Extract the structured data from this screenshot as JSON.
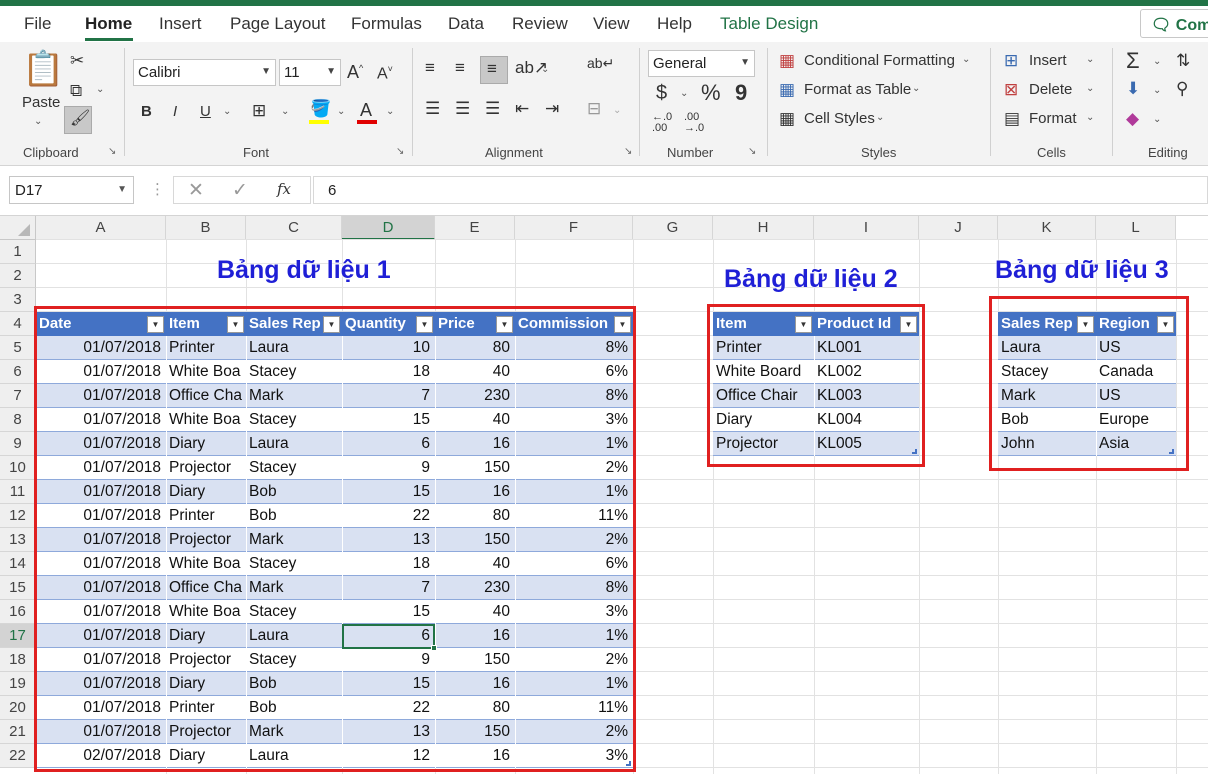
{
  "ribbon_tabs": [
    "File",
    "Home",
    "Insert",
    "Page Layout",
    "Formulas",
    "Data",
    "Review",
    "View",
    "Help",
    "Table Design"
  ],
  "comments_label": "Comm",
  "clipboard": {
    "paste_label": "Paste",
    "group_label": "Clipboard"
  },
  "font": {
    "name": "Calibri",
    "size": "11",
    "group_label": "Font"
  },
  "alignment": {
    "group_label": "Alignment"
  },
  "number": {
    "format": "General",
    "group_label": "Number",
    "currency": "$",
    "percent": "%",
    "comma": "9"
  },
  "styles": {
    "conditional": "Conditional Formatting",
    "format_table": "Format as Table",
    "cell_styles": "Cell Styles",
    "group_label": "Styles"
  },
  "cells": {
    "insert": "Insert",
    "delete": "Delete",
    "format": "Format",
    "group_label": "Cells"
  },
  "editing": {
    "group_label": "Editing",
    "sum": "Σ"
  },
  "formula_bar": {
    "name_box": "D17",
    "value": "6",
    "fx": "fx"
  },
  "columns": [
    "A",
    "B",
    "C",
    "D",
    "E",
    "F",
    "G",
    "H",
    "I",
    "J",
    "K",
    "L"
  ],
  "rows": [
    "1",
    "2",
    "3",
    "4",
    "5",
    "6",
    "7",
    "8",
    "9",
    "10",
    "11",
    "12",
    "13",
    "14",
    "15",
    "16",
    "17",
    "18",
    "19",
    "20",
    "21",
    "22"
  ],
  "selected_cell": "D17",
  "titles": {
    "t1": "Bảng dữ liệu 1",
    "t2": "Bảng dữ liệu 2",
    "t3": "Bảng dữ liệu 3"
  },
  "table1": {
    "headers": [
      "Date",
      "Item",
      "Sales Rep",
      "Quantity",
      "Price",
      "Commission"
    ],
    "rows": [
      [
        "01/07/2018",
        "Printer",
        "Laura",
        "10",
        "80",
        "8%"
      ],
      [
        "01/07/2018",
        "White Boa",
        "Stacey",
        "18",
        "40",
        "6%"
      ],
      [
        "01/07/2018",
        "Office Cha",
        "Mark",
        "7",
        "230",
        "8%"
      ],
      [
        "01/07/2018",
        "White Boa",
        "Stacey",
        "15",
        "40",
        "3%"
      ],
      [
        "01/07/2018",
        "Diary",
        "Laura",
        "6",
        "16",
        "1%"
      ],
      [
        "01/07/2018",
        "Projector",
        "Stacey",
        "9",
        "150",
        "2%"
      ],
      [
        "01/07/2018",
        "Diary",
        "Bob",
        "15",
        "16",
        "1%"
      ],
      [
        "01/07/2018",
        "Printer",
        "Bob",
        "22",
        "80",
        "11%"
      ],
      [
        "01/07/2018",
        "Projector",
        "Mark",
        "13",
        "150",
        "2%"
      ],
      [
        "01/07/2018",
        "White Boa",
        "Stacey",
        "18",
        "40",
        "6%"
      ],
      [
        "01/07/2018",
        "Office Cha",
        "Mark",
        "7",
        "230",
        "8%"
      ],
      [
        "01/07/2018",
        "White Boa",
        "Stacey",
        "15",
        "40",
        "3%"
      ],
      [
        "01/07/2018",
        "Diary",
        "Laura",
        "6",
        "16",
        "1%"
      ],
      [
        "01/07/2018",
        "Projector",
        "Stacey",
        "9",
        "150",
        "2%"
      ],
      [
        "01/07/2018",
        "Diary",
        "Bob",
        "15",
        "16",
        "1%"
      ],
      [
        "01/07/2018",
        "Printer",
        "Bob",
        "22",
        "80",
        "11%"
      ],
      [
        "01/07/2018",
        "Projector",
        "Mark",
        "13",
        "150",
        "2%"
      ],
      [
        "02/07/2018",
        "Diary",
        "Laura",
        "12",
        "16",
        "3%"
      ]
    ]
  },
  "table2": {
    "headers": [
      "Item",
      "Product Id"
    ],
    "rows": [
      [
        "Printer",
        "KL001"
      ],
      [
        "White Board",
        "KL002"
      ],
      [
        "Office Chair",
        "KL003"
      ],
      [
        "Diary",
        "KL004"
      ],
      [
        "Projector",
        "KL005"
      ]
    ]
  },
  "table3": {
    "headers": [
      "Sales Rep",
      "Region"
    ],
    "rows": [
      [
        "Laura",
        "US"
      ],
      [
        "Stacey",
        "Canada"
      ],
      [
        "Mark",
        "US"
      ],
      [
        "Bob",
        "Europe"
      ],
      [
        "John",
        "Asia"
      ]
    ]
  },
  "colors": {
    "accent": "#217346",
    "table_header": "#4472c4",
    "band": "#d9e1f2",
    "highlight_box": "#e02020",
    "title_text": "#1f1fd6"
  }
}
